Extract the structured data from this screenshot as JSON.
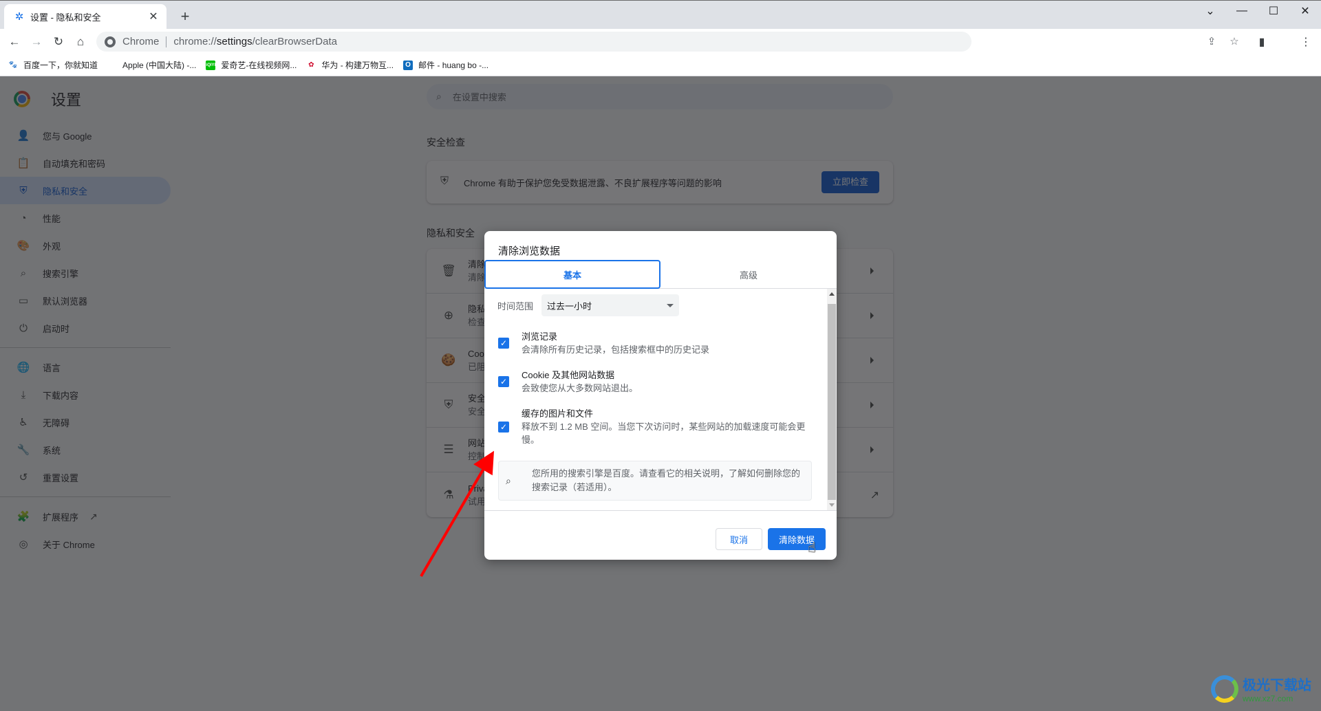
{
  "browser": {
    "tab": {
      "icon": "gear-icon",
      "title": "设置 - 隐私和安全"
    },
    "new_tab": "+",
    "window_controls": {
      "tab_search": "⌄",
      "minimize": "—",
      "maximize": "☐",
      "close": "✕"
    },
    "omnibox": {
      "site_name": "Chrome",
      "url_prefix": "chrome://",
      "url_host": "settings",
      "url_path": "/clearBrowserData"
    },
    "bookmarks": [
      {
        "icon": "baidu-icon",
        "label": "百度一下，你就知道",
        "color": "#2932e1"
      },
      {
        "icon": "apple-icon",
        "label": "Apple (中国大陆) -...",
        "color": "#555555"
      },
      {
        "icon": "iqiyi-icon",
        "label": "爱奇艺-在线视频网...",
        "color": "#00be06"
      },
      {
        "icon": "huawei-icon",
        "label": "华为 - 构建万物互...",
        "color": "#cf0a2c"
      },
      {
        "icon": "outlook-icon",
        "label": "邮件 - huang bo -...",
        "color": "#0f6cbd"
      }
    ]
  },
  "settings": {
    "title": "设置",
    "search_placeholder": "在设置中搜索",
    "nav_main": [
      {
        "icon": "person-icon",
        "label": "您与 Google",
        "active": false
      },
      {
        "icon": "clipboard-icon",
        "label": "自动填充和密码",
        "active": false
      },
      {
        "icon": "shield-icon",
        "label": "隐私和安全",
        "active": true
      },
      {
        "icon": "speedometer-icon",
        "label": "性能",
        "active": false
      },
      {
        "icon": "palette-icon",
        "label": "外观",
        "active": false
      },
      {
        "icon": "search-icon",
        "label": "搜索引擎",
        "active": false
      },
      {
        "icon": "browser-window-icon",
        "label": "默认浏览器",
        "active": false
      },
      {
        "icon": "power-icon",
        "label": "启动时",
        "active": false
      }
    ],
    "nav_advanced": [
      {
        "icon": "globe-icon",
        "label": "语言"
      },
      {
        "icon": "download-icon",
        "label": "下载内容"
      },
      {
        "icon": "accessibility-icon",
        "label": "无障碍"
      },
      {
        "icon": "wrench-icon",
        "label": "系统"
      },
      {
        "icon": "history-icon",
        "label": "重置设置"
      }
    ],
    "nav_extra": [
      {
        "icon": "puzzle-icon",
        "label": "扩展程序",
        "external": true
      },
      {
        "icon": "chrome-icon",
        "label": "关于 Chrome",
        "external": false
      }
    ],
    "safety_check": {
      "heading": "安全检查",
      "text": "Chrome 有助于保护您免受数据泄露、不良扩展程序等问题的影响",
      "button": "立即检查"
    },
    "privacy": {
      "heading": "隐私和安全",
      "rows": [
        {
          "icon": "trash-icon",
          "title": "清除",
          "sub": "清除"
        },
        {
          "icon": "privacy-guide-icon",
          "title": "隐私",
          "sub": "检查"
        },
        {
          "icon": "cookie-icon",
          "title": "Cook",
          "sub": "已阻"
        },
        {
          "icon": "security-shield-icon",
          "title": "安全",
          "sub": "安全"
        },
        {
          "icon": "tune-icon",
          "title": "网站",
          "sub": "控制"
        },
        {
          "icon": "flask-icon",
          "title": "Priva",
          "sub": "试用"
        }
      ]
    }
  },
  "dialog": {
    "title": "清除浏览数据",
    "tabs": [
      {
        "label": "基本",
        "active": true
      },
      {
        "label": "高级",
        "active": false
      }
    ],
    "time_range_label": "时间范围",
    "time_range_value": "过去一小时",
    "options": [
      {
        "title": "浏览记录",
        "sub": "会清除所有历史记录，包括搜索框中的历史记录",
        "checked": true
      },
      {
        "title": "Cookie 及其他网站数据",
        "sub": "会致使您从大多数网站退出。",
        "checked": true
      },
      {
        "title": "缓存的图片和文件",
        "sub": "释放不到 1.2 MB 空间。当您下次访问时，某些网站的加载速度可能会更慢。",
        "checked": true
      }
    ],
    "search_engine_note": "您所用的搜索引擎是百度。请查看它的相关说明，了解如何删除您的搜索记录（若适用）。",
    "cancel_button": "取消",
    "clear_button": "清除数据"
  },
  "watermark": {
    "name": "极光下载站",
    "url": "www.xz7.com"
  },
  "colors": {
    "accent": "#1a73e8",
    "annotation_arrow": "#ff0000"
  }
}
